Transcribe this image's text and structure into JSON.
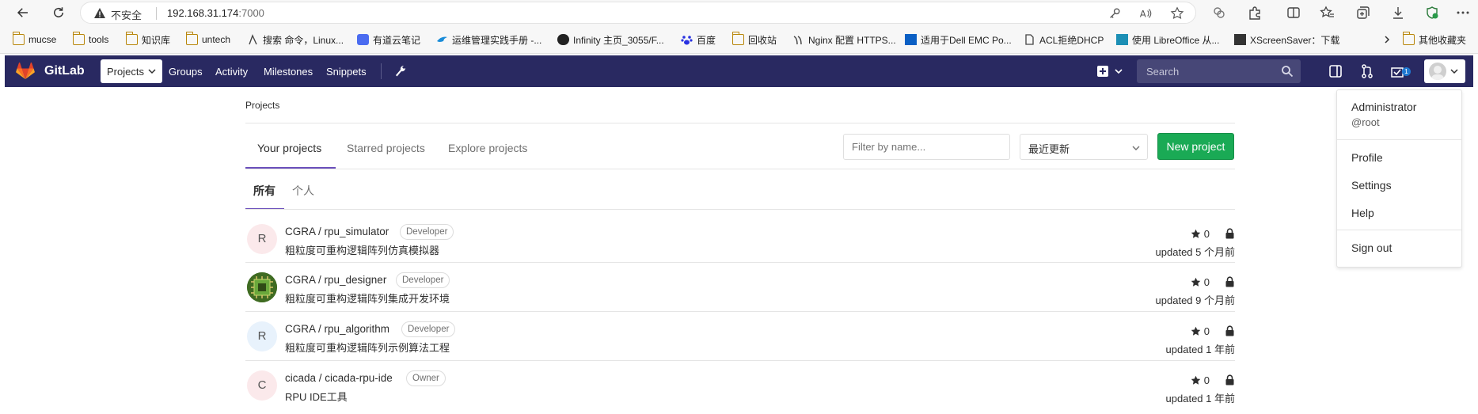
{
  "browser": {
    "insecure_label": "不安全",
    "url_host": "192.168.31.174",
    "url_port": ":7000",
    "bookmarks": [
      {
        "label": "mucse",
        "icon": "folder-icon"
      },
      {
        "label": "tools",
        "icon": "folder-icon"
      },
      {
        "label": "知识库",
        "icon": "folder-icon"
      },
      {
        "label": "untech",
        "icon": "folder-icon"
      },
      {
        "label": "搜索 命令，Linux...",
        "icon": "linux-icon"
      },
      {
        "label": "有道云笔记",
        "icon": "youdao-icon"
      },
      {
        "label": "运维管理实践手册 -...",
        "icon": "bird-icon"
      },
      {
        "label": "Infinity 主页_3055/F...",
        "icon": "infinity-icon"
      },
      {
        "label": "百度",
        "icon": "baidu-icon"
      },
      {
        "label": "回收站",
        "icon": "folder-icon"
      },
      {
        "label": "Nginx 配置 HTTPS...",
        "icon": "nginx-icon"
      },
      {
        "label": "适用于Dell EMC Po...",
        "icon": "dell-icon"
      },
      {
        "label": "ACL拒绝DHCP",
        "icon": "document-icon"
      },
      {
        "label": "使用 LibreOffice 从...",
        "icon": "libreoffice-icon"
      },
      {
        "label": "XScreenSaver：下载",
        "icon": "xscreensaver-icon"
      }
    ],
    "other_bookmarks": "其他收藏夹"
  },
  "header": {
    "brand": "GitLab",
    "projects_label": "Projects",
    "nav": [
      "Groups",
      "Activity",
      "Milestones",
      "Snippets"
    ],
    "search_placeholder": "Search",
    "todo_count": "1",
    "colors": {
      "header_bg": "#292961",
      "search_bg": "#474777",
      "badge": "#1f78d1"
    }
  },
  "main": {
    "breadcrumb": "Projects",
    "tabs": [
      "Your projects",
      "Starred projects",
      "Explore projects"
    ],
    "filter_placeholder": "Filter by name...",
    "sort_selected": "最近更新",
    "new_project_label": "New project",
    "subtabs": [
      "所有",
      "个人"
    ],
    "projects": [
      {
        "avatar_letter": "R",
        "avatar_color": "#fbe9eb",
        "title": "CGRA / rpu_simulator",
        "role": "Developer",
        "description": "粗粒度可重构逻辑阵列仿真模拟器",
        "stars": "0",
        "updated": "updated 5 个月前"
      },
      {
        "avatar_letter": "",
        "avatar_color": "#4a7a2a",
        "title": "CGRA / rpu_designer",
        "role": "Developer",
        "description": "粗粒度可重构逻辑阵列集成开发环境",
        "stars": "0",
        "updated": "updated 9 个月前"
      },
      {
        "avatar_letter": "R",
        "avatar_color": "#e8f2fc",
        "title": "CGRA / rpu_algorithm",
        "role": "Developer",
        "description": "粗粒度可重构逻辑阵列示例算法工程",
        "stars": "0",
        "updated": "updated 1 年前"
      },
      {
        "avatar_letter": "C",
        "avatar_color": "#fbe9eb",
        "title": "cicada / cicada-rpu-ide",
        "role": "Owner",
        "description": "RPU IDE工具",
        "stars": "0",
        "updated": "updated 1 年前"
      }
    ],
    "colors": {
      "accent": "#6b4fbb",
      "new_button": "#1aaa55"
    }
  },
  "user_menu": {
    "name": "Administrator",
    "username": "@root",
    "items": [
      "Profile",
      "Settings",
      "Help"
    ],
    "sign_out": "Sign out"
  }
}
